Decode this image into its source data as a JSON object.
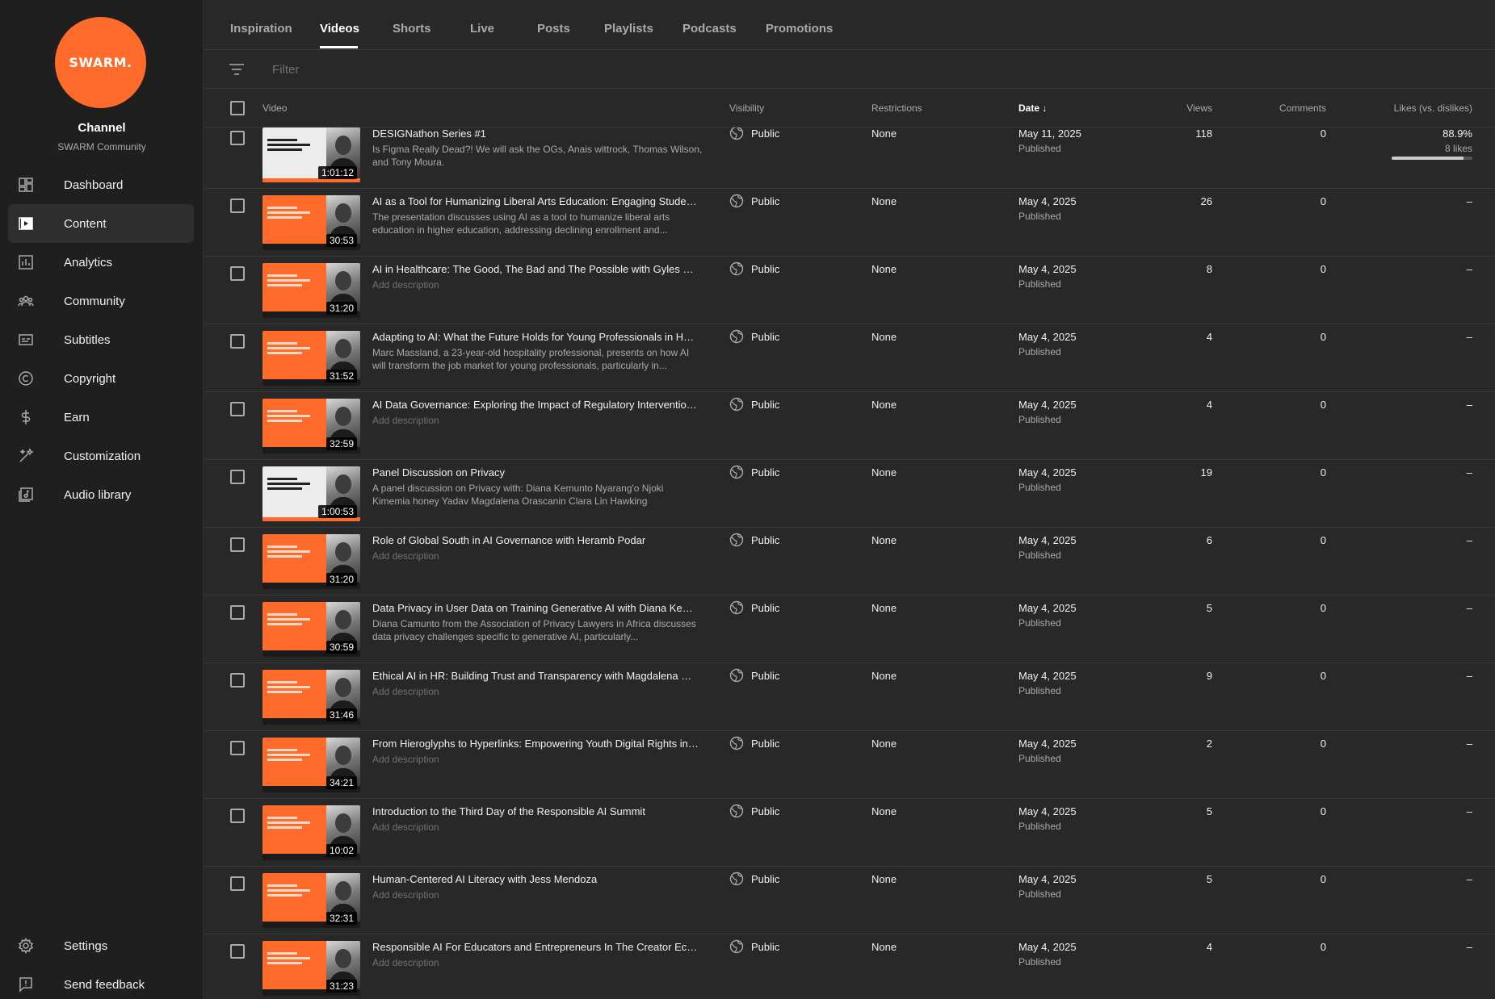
{
  "sidebar": {
    "logo_text": "SWARM.",
    "channel_label": "Channel",
    "channel_name": "SWARM Community",
    "nav": [
      {
        "label": "Dashboard",
        "icon": "dashboard-icon",
        "active": false
      },
      {
        "label": "Content",
        "icon": "content-icon",
        "active": true
      },
      {
        "label": "Analytics",
        "icon": "analytics-icon",
        "active": false
      },
      {
        "label": "Community",
        "icon": "community-icon",
        "active": false
      },
      {
        "label": "Subtitles",
        "icon": "subtitles-icon",
        "active": false
      },
      {
        "label": "Copyright",
        "icon": "copyright-icon",
        "active": false
      },
      {
        "label": "Earn",
        "icon": "earn-icon",
        "active": false
      },
      {
        "label": "Customization",
        "icon": "customization-icon",
        "active": false
      },
      {
        "label": "Audio library",
        "icon": "audio-library-icon",
        "active": false
      }
    ],
    "bottom": [
      {
        "label": "Settings",
        "icon": "settings-icon"
      },
      {
        "label": "Send feedback",
        "icon": "feedback-icon"
      }
    ]
  },
  "tabs": [
    "Inspiration",
    "Videos",
    "Shorts",
    "Live",
    "Posts",
    "Playlists",
    "Podcasts",
    "Promotions"
  ],
  "active_tab": "Videos",
  "filter": {
    "placeholder": "Filter",
    "value": ""
  },
  "columns": {
    "video": "Video",
    "visibility": "Visibility",
    "restrictions": "Restrictions",
    "date": "Date",
    "views": "Views",
    "comments": "Comments",
    "likes": "Likes (vs. dislikes)"
  },
  "sort": {
    "column": "Date",
    "direction": "descending"
  },
  "videos": [
    {
      "title": "DESIGNathon Series #1",
      "description": "Is Figma Really Dead?! We will ask the OGs, Anais wittrock, Thomas Wilson, and Tony Moura.",
      "duration": "1:01:12",
      "visibility": "Public",
      "restrictions": "None",
      "date": "May 11, 2025",
      "status": "Published",
      "views": "118",
      "comments": "0",
      "likes": "88.9%",
      "likes_sub": "8 likes",
      "likes_ratio": 0.889
    },
    {
      "title": "AI as a Tool for Humanizing Liberal Arts Education: Engaging Students in the Age of Automation",
      "description": "The presentation discusses using AI as a tool to humanize liberal arts education in higher education, addressing declining enrollment and...",
      "duration": "30:53",
      "visibility": "Public",
      "restrictions": "None",
      "date": "May 4, 2025",
      "status": "Published",
      "views": "26",
      "comments": "0",
      "likes": "–"
    },
    {
      "title": "AI in Healthcare: The Good, The Bad and The Possible with Gyles Morrison",
      "description": "Add description",
      "duration": "31:20",
      "visibility": "Public",
      "restrictions": "None",
      "date": "May 4, 2025",
      "status": "Published",
      "views": "8",
      "comments": "0",
      "likes": "–"
    },
    {
      "title": "Adapting to AI: What the Future Holds for Young Professionals in Hospitality",
      "description": "Marc Massland, a 23-year-old hospitality professional, presents on how AI will transform the job market for young professionals, particularly in...",
      "duration": "31:52",
      "visibility": "Public",
      "restrictions": "None",
      "date": "May 4, 2025",
      "status": "Published",
      "views": "4",
      "comments": "0",
      "likes": "–"
    },
    {
      "title": "AI Data Governance: Exploring the Impact of Regulatory Interventions on AI Development",
      "description": "Add description",
      "duration": "32:59",
      "visibility": "Public",
      "restrictions": "None",
      "date": "May 4, 2025",
      "status": "Published",
      "views": "4",
      "comments": "0",
      "likes": "–"
    },
    {
      "title": "Panel Discussion on Privacy",
      "description": "A panel discussion on Privacy with: Diana Kemunto Nyarang'o Njoki Kimemia honey Yadav Magdalena Orascanin Clara Lin Hawking",
      "duration": "1:00:53",
      "visibility": "Public",
      "restrictions": "None",
      "date": "May 4, 2025",
      "status": "Published",
      "views": "19",
      "comments": "0",
      "likes": "–"
    },
    {
      "title": "Role of Global South in AI Governance with Heramb Podar",
      "description": "Add description",
      "duration": "31:20",
      "visibility": "Public",
      "restrictions": "None",
      "date": "May 4, 2025",
      "status": "Published",
      "views": "6",
      "comments": "0",
      "likes": "–"
    },
    {
      "title": "Data Privacy in User Data on Training Generative AI with Diana Kemunto",
      "description": "Diana Camunto from the Association of Privacy Lawyers in Africa discusses data privacy challenges specific to generative AI, particularly...",
      "duration": "30:59",
      "visibility": "Public",
      "restrictions": "None",
      "date": "May 4, 2025",
      "status": "Published",
      "views": "5",
      "comments": "0",
      "likes": "–"
    },
    {
      "title": "Ethical AI in HR: Building Trust and Transparency with Magdalena Orascanin",
      "description": "Add description",
      "duration": "31:46",
      "visibility": "Public",
      "restrictions": "None",
      "date": "May 4, 2025",
      "status": "Published",
      "views": "9",
      "comments": "0",
      "likes": "–"
    },
    {
      "title": "From Hieroglyphs to Hyperlinks: Empowering Youth Digital Rights in the AI Era",
      "description": "Add description",
      "duration": "34:21",
      "visibility": "Public",
      "restrictions": "None",
      "date": "May 4, 2025",
      "status": "Published",
      "views": "2",
      "comments": "0",
      "likes": "–"
    },
    {
      "title": "Introduction to the Third Day of the Responsible AI Summit",
      "description": "Add description",
      "duration": "10:02",
      "visibility": "Public",
      "restrictions": "None",
      "date": "May 4, 2025",
      "status": "Published",
      "views": "5",
      "comments": "0",
      "likes": "–"
    },
    {
      "title": "Human-Centered AI Literacy with Jess Mendoza",
      "description": "Add description",
      "duration": "32:31",
      "visibility": "Public",
      "restrictions": "None",
      "date": "May 4, 2025",
      "status": "Published",
      "views": "5",
      "comments": "0",
      "likes": "–"
    },
    {
      "title": "Responsible AI For Educators and Entrepreneurs In The Creator Economy",
      "description": "Add description",
      "duration": "31:23",
      "visibility": "Public",
      "restrictions": "None",
      "date": "May 4, 2025",
      "status": "Published",
      "views": "4",
      "comments": "0",
      "likes": "–"
    }
  ],
  "colors": {
    "brand": "#ff6b2b",
    "background": "#282828",
    "sidebar": "#1f1f1f"
  }
}
